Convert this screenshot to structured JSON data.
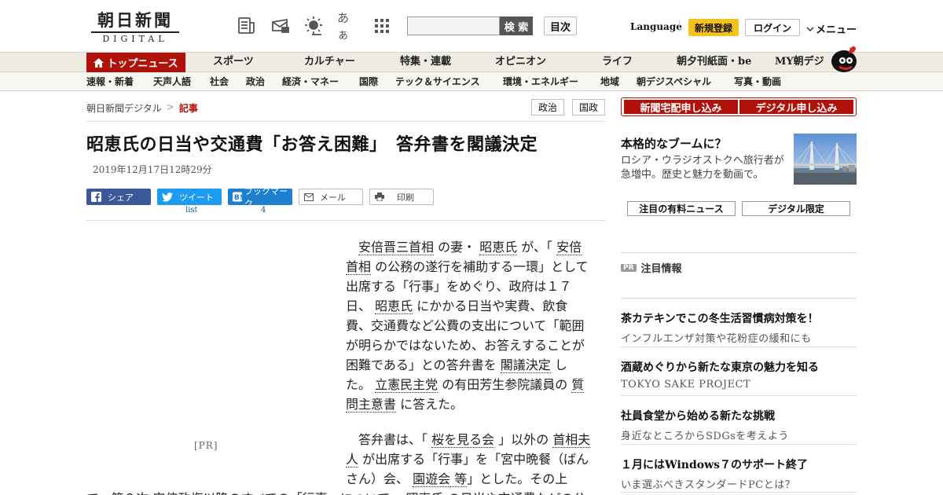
{
  "header": {
    "logo_kanji": "朝日新聞",
    "logo_sub": "DIGITAL",
    "icons": [
      "newspaper-icon",
      "mail-icon",
      "weather-sun-icon",
      "font-size-icon",
      "grid-apps-icon"
    ],
    "font_size_glyph": "あぁ",
    "search": {
      "placeholder": "",
      "button": "検 索"
    },
    "index_label": "目次",
    "language_label": "Language",
    "register_label": "新規登録",
    "login_label": "ログイン",
    "menu_label": "メニュー"
  },
  "nav_main": {
    "top_news": "トップニュース",
    "items": [
      "スポーツ",
      "カルチャー",
      "特集・連載",
      "オピニオン",
      "ライフ",
      "朝夕刊紙面・be",
      "MY朝デジ"
    ]
  },
  "nav_sub": {
    "items": [
      "速報・新着",
      "天声人語",
      "社会",
      "政治",
      "経済・マネー",
      "国際",
      "テック＆サイエンス",
      "環境・エネルギー",
      "地域",
      "朝デジスペシャル",
      "写真・動画"
    ]
  },
  "breadcrumb": {
    "home": "朝日新聞デジタル",
    "sep": ">",
    "current": "記事"
  },
  "tags": [
    "政治",
    "国政"
  ],
  "article": {
    "headline": "昭恵氏の日当や交通費「お答え困難」　答弁書を閣議決定",
    "date": "2019年12月17日12時29分",
    "share": {
      "facebook": "シェア",
      "twitter": "ツイート",
      "twitter_count": "list",
      "hatena": "ブックマーク",
      "hatena_count": "4",
      "mail": "メール",
      "print": "印刷"
    },
    "pr_label": "[PR]",
    "p1": {
      "t1": "安倍晋三首相",
      "t2": " の妻・ ",
      "t3": "昭恵氏",
      "t4": " が、「 ",
      "t5": "安倍首相",
      "t6": " の公務の遂行を補助する一環」として出席する「行事」をめぐり、政府は１７日、 ",
      "t7": "昭恵氏",
      "t8": " にかかる日当や実費、飲食費、交通費など公費の支出について「範囲が明らかではないため、お答えすることが困難である」との答弁書を ",
      "t9": "閣議決定",
      "t10": " した。 ",
      "t11": "立憲民主党",
      "t12": " の有田芳生参院議員の ",
      "t13": "質問主意書",
      "t14": " に答えた。"
    },
    "p2": {
      "t1": "答弁書は、「 ",
      "t2": "桜を見る会",
      "t3": " 」以外の ",
      "t4": "首相夫人",
      "t5": " が出席する「行事」を「宮中晩餐（ばんさん）会、 ",
      "t6": "園遊会",
      "t7": " 等",
      "t8": "」とした。その上"
    },
    "p3": "で、第２次 安倍政権以降のすべての「行事」について、 昭恵氏 の日当や交通費などの公"
  },
  "sidebar": {
    "subscribe_paper": "新聞宅配申し込み",
    "subscribe_digital": "デジタル申し込み",
    "promo": {
      "title": "本格的なブームに？",
      "desc": "ロシア・ウラジオストクへ旅行者が急増中。歴史と魅力を動画で。"
    },
    "tabs": [
      "注目の有料ニュース",
      "デジタル限定"
    ],
    "pr_badge": "PR",
    "pr_title": "注目情報",
    "ads": [
      {
        "title": "茶カテキンでこの冬生活習慣病対策を！",
        "sub": "インフルエンザ対策や花粉症の緩和にも"
      },
      {
        "title": "酒蔵めぐりから新たな東京の魅力を知る",
        "sub": "TOKYO SAKE PROJECT"
      },
      {
        "title": "社員食堂から始める新たな挑戦",
        "sub": "身近なところからSDGsを考えよう"
      },
      {
        "title": "１月にはWindows７のサポート終了",
        "sub": "いま選ぶべきスタンダードPCとは？"
      }
    ]
  },
  "colors": {
    "brand_red": "#b0120a",
    "register_yellow": "#f5c11b",
    "facebook": "#3b5998",
    "twitter": "#1d9bf0",
    "hatena": "#1e7fd1"
  }
}
